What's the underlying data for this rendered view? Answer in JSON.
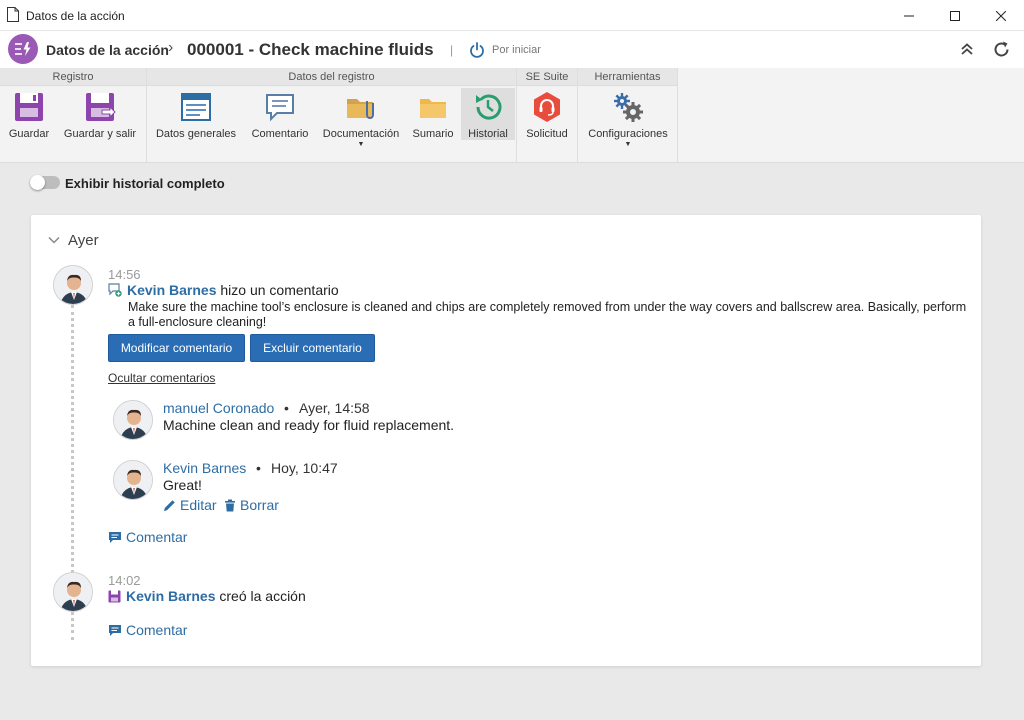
{
  "window": {
    "title": "Datos de la acción"
  },
  "header": {
    "section": "Datos de la acción",
    "separator": "›",
    "record_title": "000001 - Check machine fluids",
    "pipe": "|",
    "status": "Por iniciar"
  },
  "ribbon": {
    "groups": [
      {
        "label": "Registro"
      },
      {
        "label": "Datos del registro"
      },
      {
        "label": "SE Suite"
      },
      {
        "label": "Herramientas"
      }
    ],
    "buttons": {
      "save": "Guardar",
      "save_exit": "Guardar y salir",
      "general": "Datos generales",
      "comment": "Comentario",
      "documentation": "Documentación",
      "summary": "Sumario",
      "history": "Historial",
      "request": "Solicitud",
      "settings": "Configuraciones"
    },
    "caret": "▼"
  },
  "toggle": {
    "label": "Exhibir historial completo",
    "on": false
  },
  "timeline": {
    "day": "Ayer",
    "event1": {
      "time": "14:56",
      "user": "Kevin Barnes",
      "action": "hizo un comentario",
      "body": "Make sure the machine tool’s enclosure is cleaned and chips are completely removed from under the way covers and ballscrew area. Basically, perform a full-enclosure cleaning!",
      "edit_button": "Modificar comentario",
      "delete_button": "Excluir comentario",
      "hide_link": "Ocultar comentarios",
      "replies": [
        {
          "user": "manuel Coronado",
          "bullet": "•",
          "when": "Ayer, 14:58",
          "text": "Machine clean and ready for fluid replacement."
        },
        {
          "user": "Kevin Barnes",
          "bullet": "•",
          "when": "Hoy, 10:47",
          "text": "Great!",
          "edit": "Editar",
          "delete": "Borrar"
        }
      ],
      "comment_link": "Comentar"
    },
    "event2": {
      "time": "14:02",
      "user": "Kevin Barnes",
      "action": "creó la acción",
      "comment_link": "Comentar"
    }
  },
  "colors": {
    "accent": "#2e6da4",
    "button": "#2a6db5",
    "brand": "#9b59b6",
    "history_green": "#2a9d6f",
    "request_red": "#e74c3c"
  }
}
